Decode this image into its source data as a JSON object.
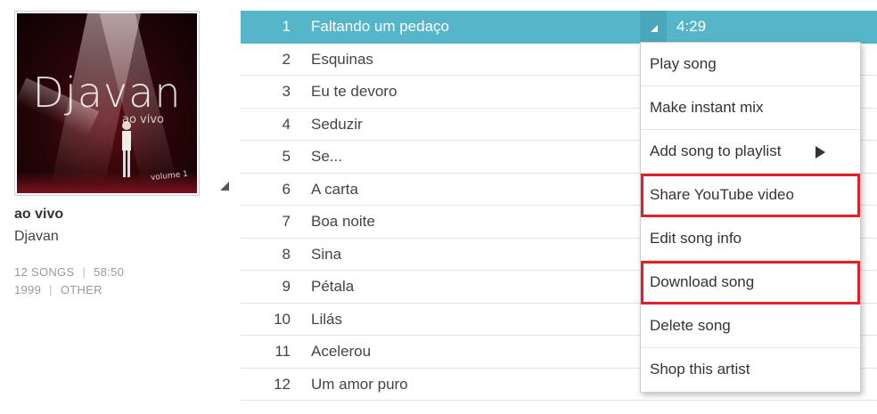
{
  "album": {
    "cover_title": "Djavan",
    "cover_subtitle": "ao vivo",
    "cover_volume": "volume 1",
    "title": "ao vivo",
    "artist": "Djavan",
    "song_count": "12 SONGS",
    "duration": "58:50",
    "year": "1999",
    "genre": "OTHER"
  },
  "tracks": [
    {
      "num": "1",
      "title": "Faltando um pedaço",
      "duration": "4:29"
    },
    {
      "num": "2",
      "title": "Esquinas"
    },
    {
      "num": "3",
      "title": "Eu te devoro"
    },
    {
      "num": "4",
      "title": "Seduzir"
    },
    {
      "num": "5",
      "title": "Se..."
    },
    {
      "num": "6",
      "title": "A carta"
    },
    {
      "num": "7",
      "title": "Boa noite"
    },
    {
      "num": "8",
      "title": "Sina"
    },
    {
      "num": "9",
      "title": "Pétala"
    },
    {
      "num": "10",
      "title": "Lilás"
    },
    {
      "num": "11",
      "title": "Acelerou"
    },
    {
      "num": "12",
      "title": "Um amor puro"
    }
  ],
  "menu": {
    "items": [
      {
        "label": "Play song"
      },
      {
        "label": "Make instant mix"
      },
      {
        "label": "Add song to playlist"
      },
      {
        "label": "Share YouTube video"
      },
      {
        "label": "Edit song info"
      },
      {
        "label": "Download song"
      },
      {
        "label": "Delete song"
      },
      {
        "label": "Shop this artist"
      }
    ]
  },
  "colors": {
    "active_row": "#55b5c9",
    "highlight_box": "#e0202a"
  }
}
